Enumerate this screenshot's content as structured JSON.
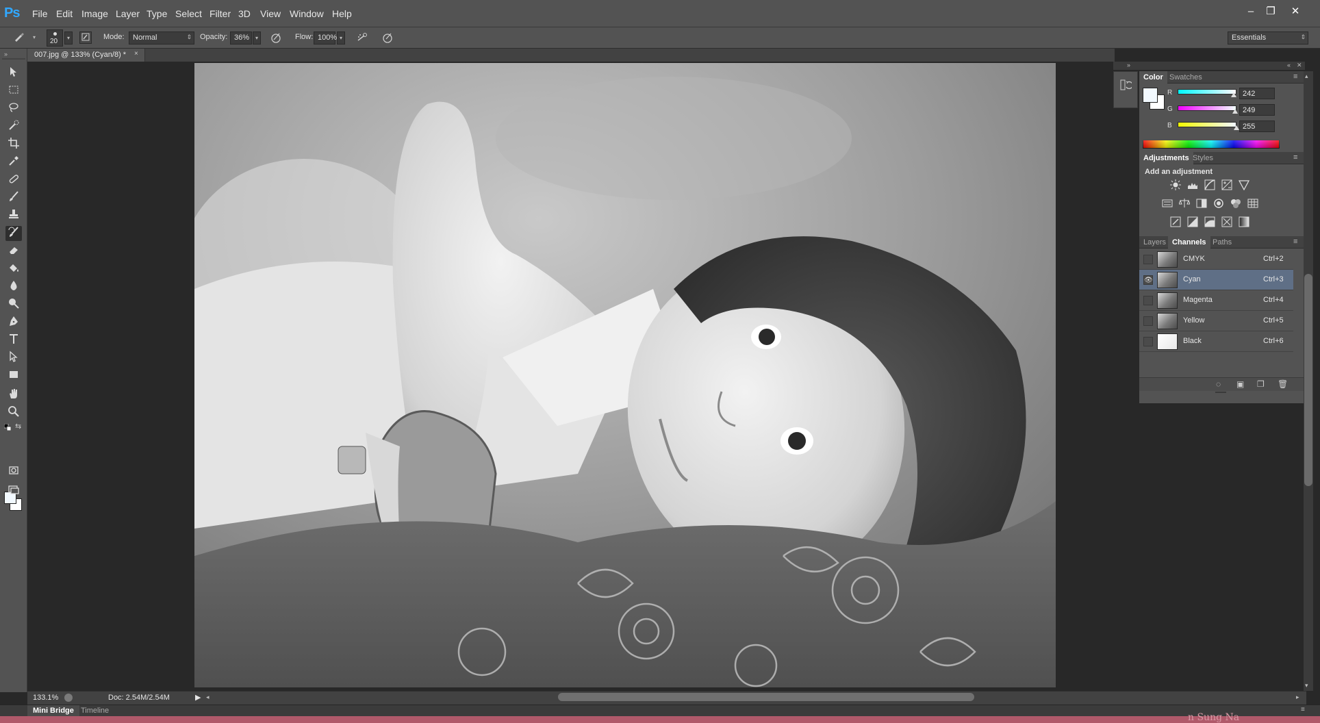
{
  "app": {
    "logo": "Ps"
  },
  "menu": [
    "File",
    "Edit",
    "Image",
    "Layer",
    "Type",
    "Select",
    "Filter",
    "3D",
    "View",
    "Window",
    "Help"
  ],
  "window_controls": {
    "minimize": "–",
    "restore": "❐",
    "close": "✕"
  },
  "options": {
    "brush_size": "20",
    "mode_label": "Mode:",
    "mode_value": "Normal",
    "opacity_label": "Opacity:",
    "opacity_value": "36%",
    "flow_label": "Flow:",
    "flow_value": "100%",
    "workspace": "Essentials"
  },
  "document": {
    "tab_title": "007.jpg @ 133% (Cyan/8) *",
    "close": "×"
  },
  "status": {
    "zoom": "133.1%",
    "doc": "Doc: 2.54M/2.54M"
  },
  "bottom_tabs": [
    "Mini Bridge",
    "Timeline"
  ],
  "color_panel": {
    "tabs": [
      "Color",
      "Swatches"
    ],
    "r_label": "R",
    "r": "242",
    "g_label": "G",
    "g": "249",
    "b_label": "B",
    "b": "255",
    "r_level": 0.949,
    "g_level": 0.976,
    "b_level": 1.0
  },
  "adjustments_panel": {
    "tabs": [
      "Adjustments",
      "Styles"
    ],
    "heading": "Add an adjustment",
    "icons_row1": [
      "brightness-contrast-icon",
      "levels-icon",
      "curves-icon",
      "exposure-icon",
      "vibrance-icon"
    ],
    "icons_row2": [
      "hue-saturation-icon",
      "color-balance-icon",
      "black-white-icon",
      "photo-filter-icon",
      "channel-mixer-icon",
      "color-lookup-icon"
    ],
    "icons_row3": [
      "invert-icon",
      "posterize-icon",
      "threshold-icon",
      "selective-color-icon",
      "gradient-map-icon"
    ]
  },
  "channels_panel": {
    "tabs": [
      "Layers",
      "Channels",
      "Paths"
    ],
    "rows": [
      {
        "name": "CMYK",
        "shortcut": "Ctrl+2",
        "visible": false,
        "selected": false
      },
      {
        "name": "Cyan",
        "shortcut": "Ctrl+3",
        "visible": true,
        "selected": true
      },
      {
        "name": "Magenta",
        "shortcut": "Ctrl+4",
        "visible": false,
        "selected": false
      },
      {
        "name": "Yellow",
        "shortcut": "Ctrl+5",
        "visible": false,
        "selected": false
      },
      {
        "name": "Black",
        "shortcut": "Ctrl+6",
        "visible": false,
        "selected": false
      }
    ]
  },
  "watermark": "n Sung Na",
  "colors": {
    "accent_blue": "#31a8ff",
    "selected_row": "#5f6f86",
    "panel_bg": "#535353",
    "canvas_bg": "#282828"
  }
}
